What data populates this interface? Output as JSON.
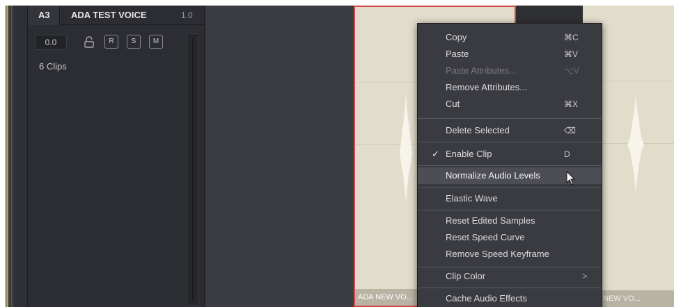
{
  "track": {
    "tag": "A3",
    "name": "ADA TEST VOICE",
    "level": "1.0",
    "volume": "0.0",
    "buttons": {
      "record": "R",
      "solo": "S",
      "mute": "M"
    },
    "clips_count": "6 Clips"
  },
  "clips": [
    {
      "label": "ADA NEW VO..."
    },
    {
      "label": "ADA NEW VO..."
    }
  ],
  "menu": {
    "items": [
      {
        "label": "Copy",
        "shortcut": "⌘C"
      },
      {
        "label": "Paste",
        "shortcut": "⌘V"
      },
      {
        "label": "Paste Attributes...",
        "shortcut": "⌥V"
      },
      {
        "label": "Remove Attributes...",
        "shortcut": ""
      },
      {
        "label": "Cut",
        "shortcut": "⌘X"
      },
      {
        "label": "Delete Selected",
        "shortcut": "⌫"
      },
      {
        "label": "Enable Clip",
        "shortcut": "D"
      },
      {
        "label": "Normalize Audio Levels",
        "shortcut": ""
      },
      {
        "label": "Elastic Wave",
        "shortcut": ""
      },
      {
        "label": "Reset Edited Samples",
        "shortcut": ""
      },
      {
        "label": "Reset Speed Curve",
        "shortcut": ""
      },
      {
        "label": "Remove Speed Keyframe",
        "shortcut": ""
      },
      {
        "label": "Clip Color",
        "shortcut": ""
      },
      {
        "label": "Cache Audio Effects",
        "shortcut": ""
      }
    ],
    "enable_clip_check": "✓",
    "submenu_arrow": ">"
  },
  "colors": {
    "selection_border": "#d24a46",
    "clip_fill": "#e2dccb",
    "menu_bg": "#3a3b41",
    "menu_highlight": "#4d4e55"
  },
  "icons": [
    "lock-icon",
    "pointer-cursor-icon",
    "checkmark-icon",
    "chevron-right-icon"
  ]
}
